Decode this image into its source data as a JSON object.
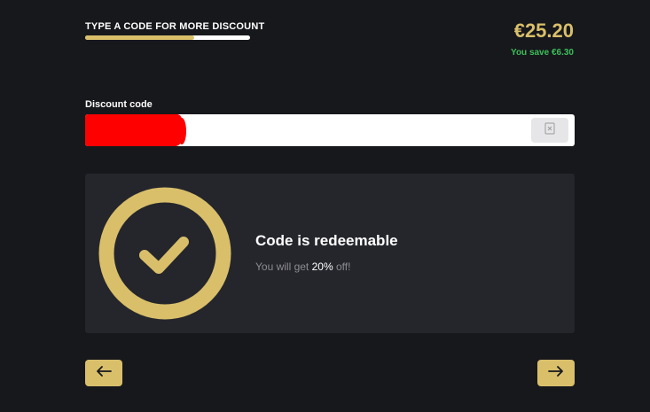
{
  "header": {
    "headline": "TYPE A CODE FOR MORE DISCOUNT",
    "progress": 0.66,
    "price": "€25.20",
    "savings": "You save €6.30"
  },
  "discount": {
    "label": "Discount code",
    "value": "",
    "clear_icon": "clear-icon"
  },
  "result": {
    "icon": "checkmark-icon",
    "title": "Code is redeemable",
    "text_prefix": "You will get ",
    "percent": "20%",
    "text_suffix": " off!"
  },
  "nav": {
    "back_icon": "arrow-left-icon",
    "next_icon": "arrow-right-icon"
  },
  "colors": {
    "background": "#17181c",
    "card": "#25262c",
    "accent": "#d9bf6a",
    "success": "#3bbf5a"
  }
}
